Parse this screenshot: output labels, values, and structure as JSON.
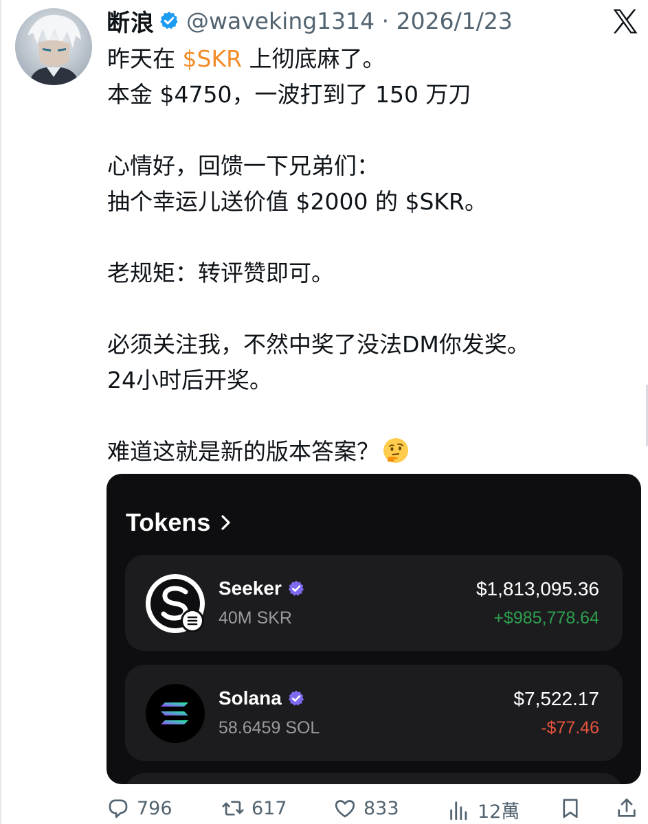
{
  "author": {
    "name": "断浪",
    "handle_date": "@waveking1314 · 2026/1/23"
  },
  "tweet": {
    "line1_before": "昨天在 ",
    "line1_cashtag": "$SKR",
    "line1_after": " 上彻底麻了。",
    "line2": "本金 $4750，一波打到了 150 万刀",
    "line3": "心情好，回馈一下兄弟们：",
    "line4": "抽个幸运儿送价值 $2000 的 $SKR。",
    "line5": "老规矩：转评赞即可。",
    "line6": "必须关注我，不然中奖了没法DM你发奖。",
    "line7": "24小时后开奖。",
    "line8": "难道这就是新的版本答案？"
  },
  "card": {
    "header": "Tokens",
    "tokens": [
      {
        "name": "Seeker",
        "amount": "40M SKR",
        "value": "$1,813,095.36",
        "change": "+$985,778.64",
        "change_color": "#2ea04f"
      },
      {
        "name": "Solana",
        "amount": "58.6459 SOL",
        "value": "$7,522.17",
        "change": "-$77.46",
        "change_color": "#e5533d"
      }
    ]
  },
  "actions": {
    "replies": "796",
    "reposts": "617",
    "likes": "833",
    "views": "12萬"
  },
  "colors": {
    "cashtag": "#f28c28",
    "verified": "#1d9bf0",
    "card_bg": "#0e0e10",
    "token_row_bg": "#1c1c1f",
    "token_verified": "#7c6af0"
  },
  "icons": [
    "verified-badge-icon",
    "x-logo-icon",
    "chevron-right-icon",
    "seeker-logo-icon",
    "solana-logo-icon",
    "reply-icon",
    "repost-icon",
    "like-icon",
    "views-icon",
    "bookmark-icon",
    "share-icon",
    "thinking-face-icon"
  ]
}
